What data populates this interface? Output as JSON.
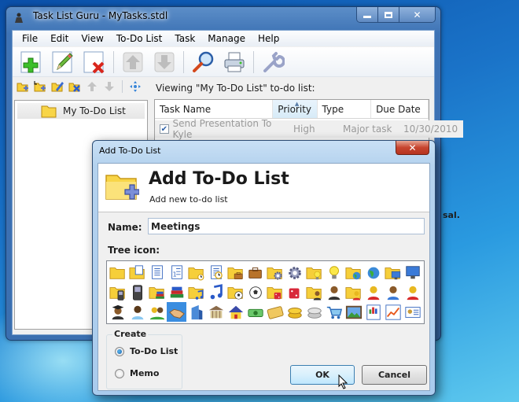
{
  "window": {
    "title": "Task List Guru - MyTasks.stdl",
    "caption_buttons": {
      "minimize": "minimize",
      "maximize": "maximize",
      "close": "close"
    }
  },
  "menu": [
    "File",
    "Edit",
    "View",
    "To-Do List",
    "Task",
    "Manage",
    "Help"
  ],
  "toolbar": [
    {
      "name": "add-task-button",
      "icon": "plus-icon",
      "enabled": true
    },
    {
      "name": "edit-task-button",
      "icon": "pencil-icon",
      "enabled": true
    },
    {
      "name": "delete-task-button",
      "icon": "delete-x-icon",
      "enabled": true
    },
    {
      "name": "move-up-button",
      "icon": "arrow-up-icon",
      "enabled": false
    },
    {
      "name": "move-down-button",
      "icon": "arrow-down-icon",
      "enabled": false
    },
    {
      "name": "search-button",
      "icon": "magnifier-icon",
      "enabled": true
    },
    {
      "name": "print-button",
      "icon": "printer-icon",
      "enabled": true
    },
    {
      "name": "settings-button",
      "icon": "wrench-icon",
      "enabled": true
    }
  ],
  "tree_toolbar": [
    {
      "name": "add-list-button",
      "icon": "folder-add-icon",
      "enabled": true
    },
    {
      "name": "add-sublist-button",
      "icon": "folder-add-sub-icon",
      "enabled": true
    },
    {
      "name": "edit-list-button",
      "icon": "folder-edit-icon",
      "enabled": true
    },
    {
      "name": "delete-list-button",
      "icon": "folder-delete-icon",
      "enabled": true
    },
    {
      "name": "list-up-button",
      "icon": "arrow-up-icon",
      "enabled": false
    },
    {
      "name": "list-down-button",
      "icon": "arrow-down-icon",
      "enabled": false
    },
    {
      "name": "move-list-button",
      "icon": "move-icon",
      "enabled": true
    }
  ],
  "tree": {
    "items": [
      {
        "label": "My To-Do List",
        "icon": "folder-icon"
      }
    ]
  },
  "viewing_label": "Viewing \"My To-Do List\" to-do list:",
  "grid": {
    "columns": [
      "Task Name",
      "Priority",
      "Type",
      "Due Date"
    ],
    "sorted_column": "Priority",
    "rows": [
      {
        "done": true,
        "task": "Send Presentation To Kyle",
        "priority": "High",
        "type": "Major task",
        "due": "10/30/2010"
      }
    ]
  },
  "notes_fragment": "sal.",
  "dialog": {
    "title": "Add To-Do List",
    "close": "close",
    "heading": "Add To-Do List",
    "subheading": "Add new to-do list",
    "name_label": "Name:",
    "name_value": "Meetings",
    "tree_icon_label": "Tree icon:",
    "tree_icons": [
      "folder",
      "folder-open",
      "document",
      "numbered-list",
      "folder-clock",
      "document-clock",
      "folder-briefcase",
      "briefcase",
      "folder-gear",
      "gear",
      "folder-bulb",
      "light-bulb",
      "folder-globe",
      "globe",
      "folder-monitor",
      "monitor",
      "folder-phone",
      "mobile-phone",
      "folder-books",
      "books",
      "folder-music",
      "music-note",
      "folder-soccer",
      "soccer-ball",
      "folder-dice",
      "dice",
      "folder-businessman",
      "businessman",
      "folder-businesswoman",
      "businesswoman",
      "user",
      "user-female",
      "graduate",
      "doctor",
      "group",
      "handshake",
      "building",
      "bank",
      "home",
      "money",
      "credit-card",
      "gold-coins",
      "silver-coins",
      "shopping-cart",
      "picture",
      "chart-report",
      "line-chart",
      "id-card"
    ],
    "selected_icon": "handshake",
    "create_group_label": "Create",
    "create_options": [
      {
        "label": "To-Do List",
        "selected": true
      },
      {
        "label": "Memo",
        "selected": false
      }
    ],
    "ok_label": "OK",
    "cancel_label": "Cancel"
  }
}
